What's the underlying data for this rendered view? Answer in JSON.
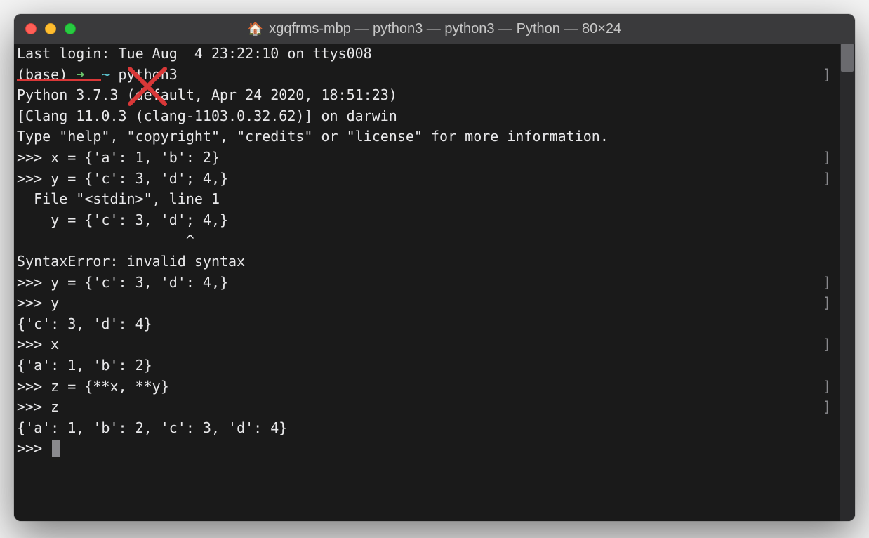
{
  "titlebar": {
    "icon": "home-icon",
    "title": "xgqfrms-mbp — python3 — python3 — Python — 80×24"
  },
  "terminal": {
    "lines": [
      {
        "type": "plain",
        "text": "Last login: Tue Aug  4 23:22:10 on ttys008",
        "bracket": false
      },
      {
        "type": "prompt",
        "base": "(base) ",
        "arrow": "➜  ",
        "tilde": "~ ",
        "cmd": "python3",
        "bracket": true
      },
      {
        "type": "plain",
        "text": "Python 3.7.3 (default, Apr 24 2020, 18:51:23)",
        "bracket": false
      },
      {
        "type": "plain",
        "text": "[Clang 11.0.3 (clang-1103.0.32.62)] on darwin",
        "bracket": false
      },
      {
        "type": "plain",
        "text": "Type \"help\", \"copyright\", \"credits\" or \"license\" for more information.",
        "bracket": false
      },
      {
        "type": "plain",
        "text": ">>> x = {'a': 1, 'b': 2}",
        "bracket": true
      },
      {
        "type": "plain",
        "text": ">>> y = {'c': 3, 'd'; 4,}",
        "bracket": true
      },
      {
        "type": "plain",
        "text": "  File \"<stdin>\", line 1",
        "bracket": false
      },
      {
        "type": "plain",
        "text": "    y = {'c': 3, 'd'; 4,}",
        "bracket": false
      },
      {
        "type": "plain",
        "text": "                    ^",
        "bracket": false
      },
      {
        "type": "plain",
        "text": "SyntaxError: invalid syntax",
        "bracket": false
      },
      {
        "type": "plain",
        "text": ">>> y = {'c': 3, 'd': 4,}",
        "bracket": true
      },
      {
        "type": "plain",
        "text": ">>> y",
        "bracket": true
      },
      {
        "type": "plain",
        "text": "{'c': 3, 'd': 4}",
        "bracket": false
      },
      {
        "type": "plain",
        "text": ">>> x",
        "bracket": true
      },
      {
        "type": "plain",
        "text": "{'a': 1, 'b': 2}",
        "bracket": false
      },
      {
        "type": "plain",
        "text": ">>> z = {**x, **y}",
        "bracket": true
      },
      {
        "type": "plain",
        "text": ">>> z",
        "bracket": true
      },
      {
        "type": "plain",
        "text": "{'a': 1, 'b': 2, 'c': 3, 'd': 4}",
        "bracket": false
      },
      {
        "type": "cursor",
        "text": ">>> ",
        "bracket": false
      }
    ]
  },
  "annotations": {
    "red_x": true,
    "red_underline": true
  }
}
